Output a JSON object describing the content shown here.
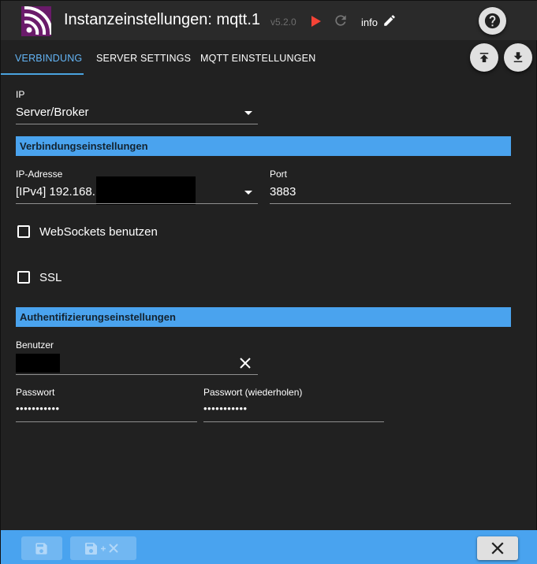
{
  "header": {
    "title": "Instanzeinstellungen: mqtt.1",
    "version": "v5.2.0",
    "info_label": "info",
    "icons": [
      "app-logo-icon",
      "play-icon",
      "reload-icon",
      "edit-pencil-icon",
      "help-icon"
    ]
  },
  "tabs": [
    {
      "label": "VERBINDUNG",
      "active": true
    },
    {
      "label": "SERVER SETTINGS",
      "active": false
    },
    {
      "label": "MQTT EINSTELLUNGEN",
      "active": false
    }
  ],
  "toolbar": {
    "icons": [
      "upload-icon",
      "download-icon"
    ]
  },
  "form": {
    "ip_label": "IP",
    "ip_value": "Server/Broker",
    "section_connection": "Verbindungseinstellungen",
    "ip_address_label": "IP-Adresse",
    "ip_address_value": "[IPv4] 192.168.",
    "port_label": "Port",
    "port_value": "3883",
    "websockets_label": "WebSockets benutzen",
    "websockets_checked": false,
    "ssl_label": "SSL",
    "ssl_checked": false,
    "section_auth": "Authentifizierungseinstellungen",
    "user_label": "Benutzer",
    "password_label": "Passwort",
    "password_value": "•••••••••••",
    "password_repeat_label": "Passwort (wiederholen)",
    "password_repeat_value": "•••••••••••"
  },
  "footer": {
    "icons": [
      "save-icon",
      "save-close-icon",
      "close-icon"
    ]
  },
  "colors": {
    "accent": "#49a3ef",
    "tab_active": "#64b5f6",
    "background": "#212121",
    "header": "#2a2a2a"
  }
}
